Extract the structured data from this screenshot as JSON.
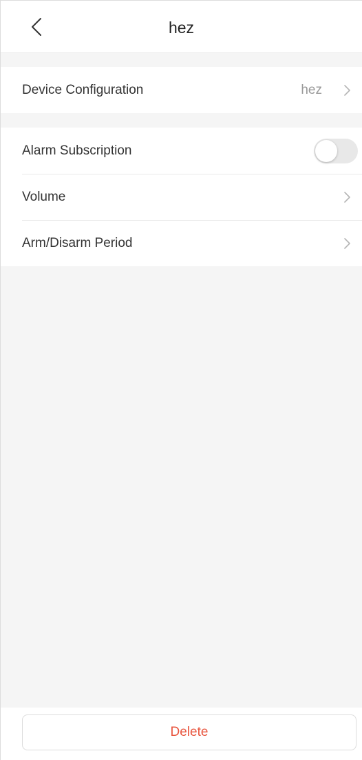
{
  "header": {
    "title": "hez",
    "back_icon": "chevron-left-icon"
  },
  "settings": {
    "device_configuration": {
      "label": "Device Configuration",
      "value": "hez",
      "icon": "chevron-right-icon"
    },
    "alarm_subscription": {
      "label": "Alarm Subscription",
      "enabled": false
    },
    "volume": {
      "label": "Volume",
      "icon": "chevron-right-icon"
    },
    "arm_disarm_period": {
      "label": "Arm/Disarm Period",
      "icon": "chevron-right-icon"
    }
  },
  "footer": {
    "delete_label": "Delete"
  },
  "colors": {
    "accent_delete": "#e8553e",
    "background": "#f5f5f5",
    "toggle_off": "#e8e8e8"
  }
}
